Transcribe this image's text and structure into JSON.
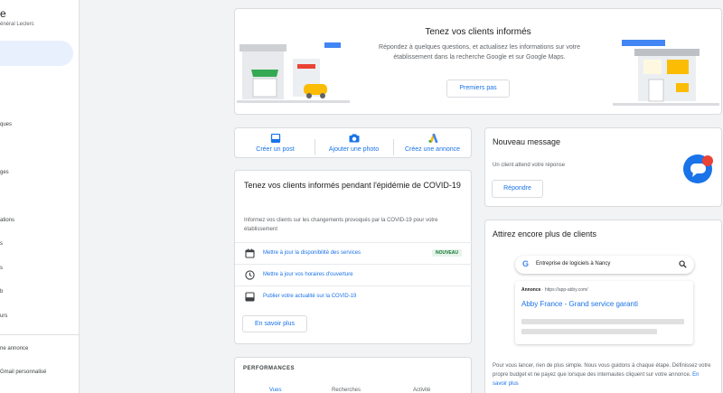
{
  "sidebar": {
    "title": "e",
    "subtitle": "énéral Leclerc",
    "items": [
      {
        "label": "ques"
      },
      {
        "label": "ges"
      },
      {
        "label": "ations"
      },
      {
        "label": "s"
      },
      {
        "label": "s"
      },
      {
        "label": "b"
      },
      {
        "label": "urs"
      }
    ],
    "bottom_items": [
      {
        "label": "ne annonce"
      },
      {
        "label": "Gmail personnalisé"
      }
    ]
  },
  "hero": {
    "title": "Tenez vos clients informés",
    "text": "Répondez à quelques questions, et actualisez les informations sur votre établissement dans la recherche Google et sur Google Maps.",
    "button": "Premiers pas"
  },
  "actions": [
    {
      "label": "Créer un post",
      "icon": "post-icon"
    },
    {
      "label": "Ajouter une photo",
      "icon": "camera-icon"
    },
    {
      "label": "Créez une annonce",
      "icon": "google-ads-icon"
    }
  ],
  "covid": {
    "title": "Tenez vos clients informés pendant l'épidémie de COVID-19",
    "text": "Informez vos clients sur les changements provoqués par la COVID-19 pour votre établissement",
    "rows": [
      {
        "label": "Mettre à jour la disponibilité des services",
        "badge": "NOUVEAU",
        "icon": "calendar-icon"
      },
      {
        "label": "Mettre à jour vos horaires d'ouverture",
        "icon": "clock-icon"
      },
      {
        "label": "Publier votre actualité sur la COVID-19",
        "icon": "post-icon"
      }
    ],
    "button": "En savoir plus"
  },
  "performance": {
    "title": "PERFORMANCES",
    "tabs": [
      "Vues",
      "Recherches",
      "Activité"
    ]
  },
  "message": {
    "title": "Nouveau message",
    "text": "Un client attend votre réponse",
    "button": "Répondre"
  },
  "attract": {
    "title": "Attirez encore plus de clients",
    "search_query": "Entreprise de logiciels à Nancy",
    "ad_label": "Annonce",
    "ad_url": "· https://app-abby.com/",
    "ad_title": "Abby France - Grand service garanti",
    "text": "Pour vous lancer, rien de plus simple. Nous vous guidons à chaque étape. Définissez votre propre budget et ne payez que lorsque des internautes cliquent sur votre annonce.",
    "link": "En savoir plus"
  },
  "colors": {
    "accent": "#1a73e8",
    "badge_bg": "#e6f4ea",
    "badge_text": "#137333",
    "notification": "#ea4335"
  }
}
